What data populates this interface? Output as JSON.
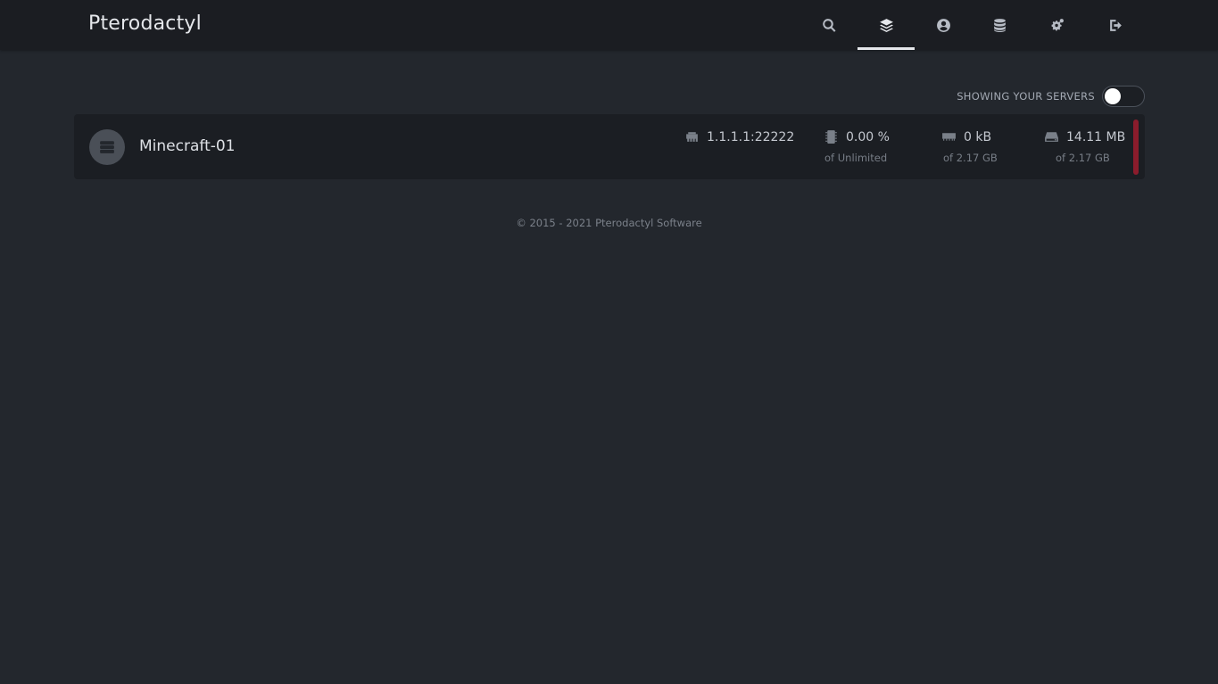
{
  "header": {
    "brand": "Pterodactyl",
    "nav": [
      {
        "icon": "search-icon"
      },
      {
        "icon": "layers-icon",
        "active": true
      },
      {
        "icon": "user-circle-icon"
      },
      {
        "icon": "database-icon"
      },
      {
        "icon": "cogs-icon"
      },
      {
        "icon": "sign-out-icon"
      }
    ]
  },
  "toggle": {
    "label": "SHOWING YOUR SERVERS",
    "on": false
  },
  "servers": [
    {
      "name": "Minecraft-01",
      "allocation": "1.1.1.1:22222",
      "cpu": {
        "value": "0.00 %",
        "limit": "of Unlimited"
      },
      "memory": {
        "value": "0 kB",
        "limit": "of 2.17 GB"
      },
      "disk": {
        "value": "14.11 MB",
        "limit": "of 2.17 GB"
      },
      "status_color": "#8b1c2c"
    }
  ],
  "footer": {
    "text": "© 2015 - 2021 Pterodactyl Software"
  },
  "colors": {
    "background": "#23272d",
    "header": "#1b1d22",
    "card": "#1b1e23",
    "status_offline": "#8b1c2c"
  }
}
